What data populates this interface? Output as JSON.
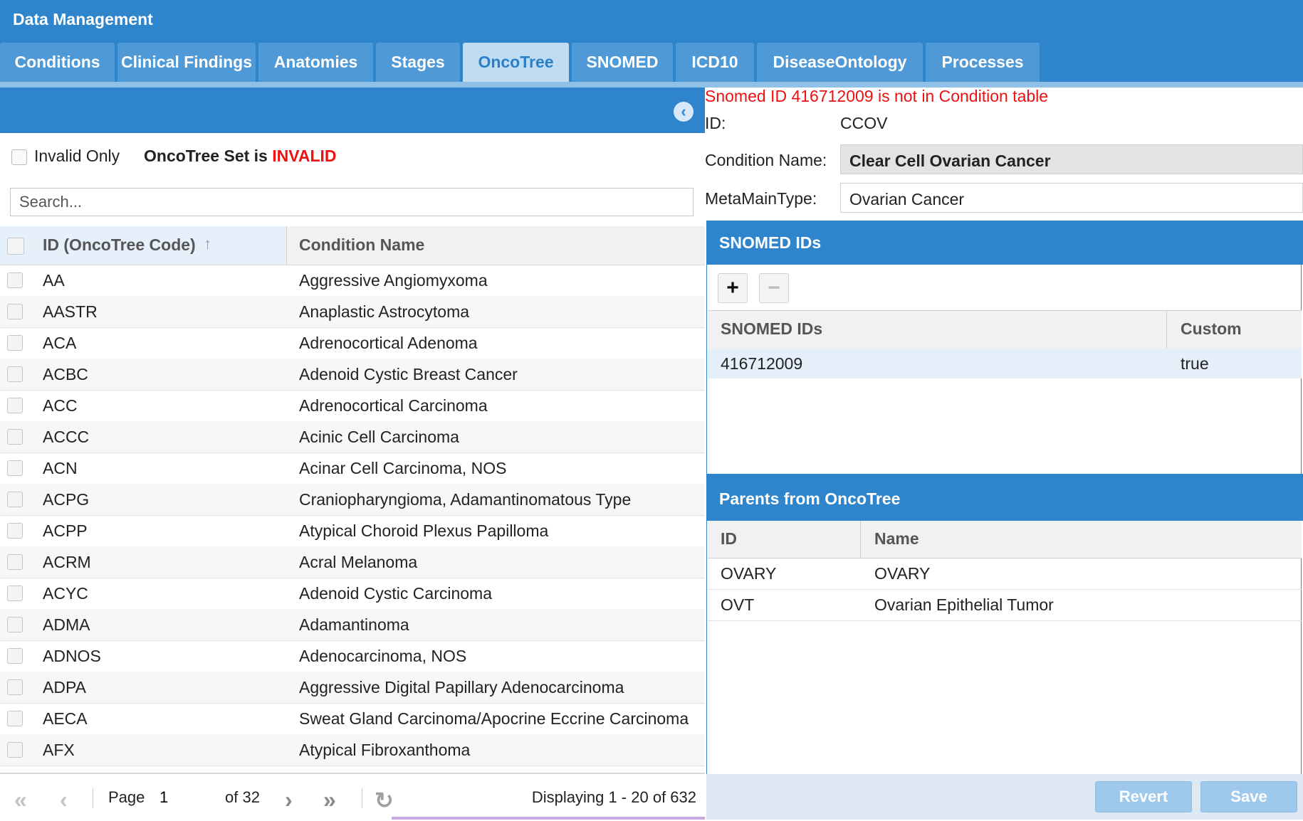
{
  "app": {
    "title": "Data Management"
  },
  "tabs": [
    {
      "label": "Conditions",
      "active": false
    },
    {
      "label": "Clinical Findings",
      "active": false
    },
    {
      "label": "Anatomies",
      "active": false
    },
    {
      "label": "Stages",
      "active": false
    },
    {
      "label": "OncoTree",
      "active": true
    },
    {
      "label": "SNOMED",
      "active": false
    },
    {
      "label": "ICD10",
      "active": false
    },
    {
      "label": "DiseaseOntology",
      "active": false
    },
    {
      "label": "Processes",
      "active": false
    }
  ],
  "left": {
    "collapse_icon": "chevron-left-circle",
    "invalid_only_label": "Invalid Only",
    "status_prefix": "OncoTree Set is ",
    "status_value": "INVALID",
    "status_color": "#ee1111",
    "search_placeholder": "Search...",
    "columns": {
      "id": "ID (OncoTree Code)",
      "name": "Condition Name"
    },
    "rows": [
      {
        "id": "AA",
        "name": "Aggressive Angiomyxoma"
      },
      {
        "id": "AASTR",
        "name": "Anaplastic Astrocytoma"
      },
      {
        "id": "ACA",
        "name": "Adrenocortical Adenoma"
      },
      {
        "id": "ACBC",
        "name": "Adenoid Cystic Breast Cancer"
      },
      {
        "id": "ACC",
        "name": "Adrenocortical Carcinoma"
      },
      {
        "id": "ACCC",
        "name": "Acinic Cell Carcinoma"
      },
      {
        "id": "ACN",
        "name": "Acinar Cell Carcinoma, NOS"
      },
      {
        "id": "ACPG",
        "name": "Craniopharyngioma, Adamantinomatous Type"
      },
      {
        "id": "ACPP",
        "name": "Atypical Choroid Plexus Papilloma"
      },
      {
        "id": "ACRM",
        "name": "Acral Melanoma"
      },
      {
        "id": "ACYC",
        "name": "Adenoid Cystic Carcinoma"
      },
      {
        "id": "ADMA",
        "name": "Adamantinoma"
      },
      {
        "id": "ADNOS",
        "name": "Adenocarcinoma, NOS"
      },
      {
        "id": "ADPA",
        "name": "Aggressive Digital Papillary Adenocarcinoma"
      },
      {
        "id": "AECA",
        "name": "Sweat Gland Carcinoma/Apocrine Eccrine Carcinoma"
      },
      {
        "id": "AFX",
        "name": "Atypical Fibroxanthoma"
      }
    ],
    "pager": {
      "page_label": "Page",
      "page_value": "1",
      "of_label": "of 32",
      "display": "Displaying 1 - 20 of 632"
    }
  },
  "right": {
    "error": "Snomed ID 416712009 is not in Condition table",
    "error_color": "#ee1111",
    "id_label": "ID:",
    "id_value": "CCOV",
    "cname_label": "Condition Name:",
    "cname_value": "Clear Cell Ovarian Cancer",
    "meta_label": "MetaMainType:",
    "meta_value": "Ovarian Cancer",
    "snomed": {
      "title": "SNOMED IDs",
      "columns": {
        "id": "SNOMED IDs",
        "custom": "Custom"
      },
      "rows": [
        {
          "id": "416712009",
          "custom": "true"
        }
      ]
    },
    "parents": {
      "title": "Parents from OncoTree",
      "columns": {
        "id": "ID",
        "name": "Name"
      },
      "rows": [
        {
          "id": "OVARY",
          "name": "OVARY"
        },
        {
          "id": "OVT",
          "name": "Ovarian Epithelial Tumor"
        }
      ]
    },
    "buttons": {
      "revert": "Revert",
      "save": "Save"
    }
  },
  "colors": {
    "brand": "#2e85cc",
    "tab_active_bg": "#bfdcf2"
  }
}
